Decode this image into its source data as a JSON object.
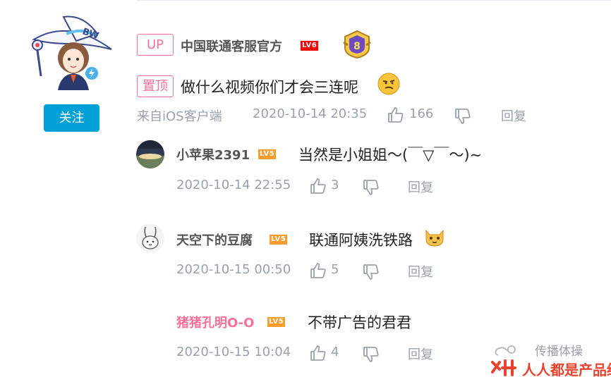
{
  "main_comment": {
    "up_badge": "UP",
    "username": "中国联通客服官方",
    "level": "LV6",
    "follow_label": "关注",
    "pin_badge": "置顶",
    "text": "做什么视频你们才会三连呢",
    "source": "来自iOS客户端",
    "timestamp": "2020-10-14 20:35",
    "likes": "166",
    "reply_label": "回复",
    "avatar_text": "BW"
  },
  "replies": [
    {
      "username": "小苹果2391",
      "level": "LV5",
      "text": "当然是小姐姐～(￣▽￣～)~",
      "timestamp": "2020-10-14 22:55",
      "likes": "3",
      "reply_label": "回复"
    },
    {
      "username": "天空下的豆腐",
      "level": "LV5",
      "text": "联通阿姨洗铁路",
      "timestamp": "2020-10-15 00:50",
      "likes": "5",
      "reply_label": "回复"
    },
    {
      "username": "猪猪孔明O-O",
      "level": "LV5",
      "text": "不带广告的君君",
      "timestamp": "2020-10-15 10:04",
      "likes": "4",
      "reply_label": "回复"
    }
  ],
  "watermark": {
    "top_text": "传播体操",
    "bottom_text": "人人都是产品经理"
  },
  "colors": {
    "follow_button": "#00a1d6",
    "badge_pink": "#fb7299",
    "meta_gray": "#99a2aa",
    "level6": "#ff0000",
    "level5": "#ff9c2b"
  }
}
